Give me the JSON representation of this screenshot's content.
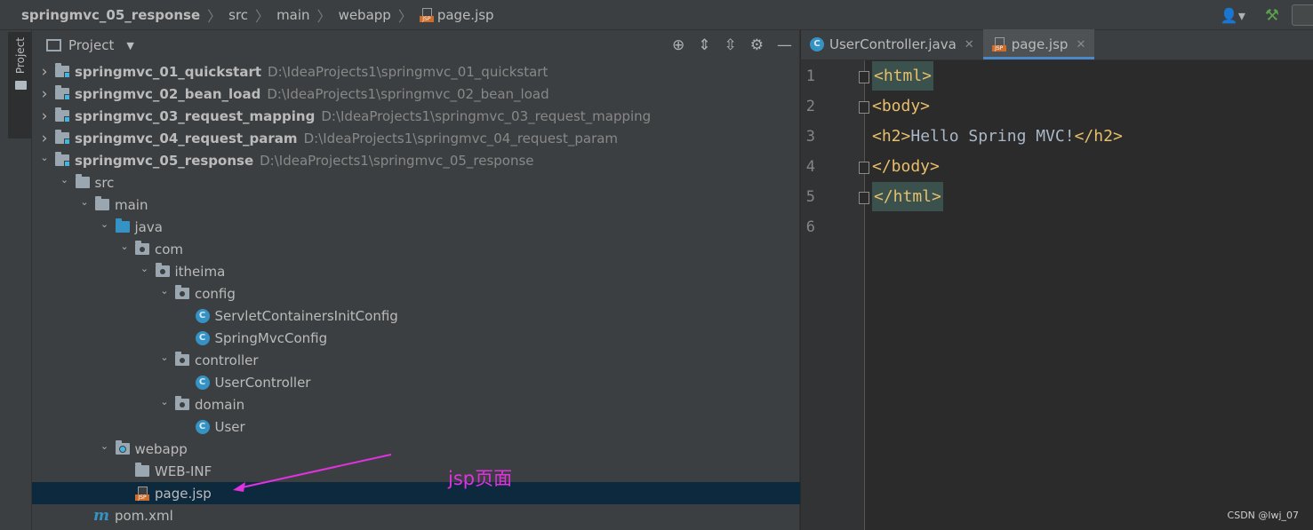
{
  "breadcrumb": [
    "springmvc_05_response",
    "src",
    "main",
    "webapp",
    "page.jsp"
  ],
  "project_panel": {
    "title": "Project",
    "stripe_label": "Project"
  },
  "tree": [
    {
      "name": "springmvc_01_quickstart",
      "path": "D:\\IdeaProjects1\\springmvc_01_quickstart",
      "level": 0,
      "arrow": "collapsed",
      "icon": "module-folder-icon",
      "bold": true
    },
    {
      "name": "springmvc_02_bean_load",
      "path": "D:\\IdeaProjects1\\springmvc_02_bean_load",
      "level": 0,
      "arrow": "collapsed",
      "icon": "module-folder-icon",
      "bold": true
    },
    {
      "name": "springmvc_03_request_mapping",
      "path": "D:\\IdeaProjects1\\springmvc_03_request_mapping",
      "level": 0,
      "arrow": "collapsed",
      "icon": "module-folder-icon",
      "bold": true
    },
    {
      "name": "springmvc_04_request_param",
      "path": "D:\\IdeaProjects1\\springmvc_04_request_param",
      "level": 0,
      "arrow": "collapsed",
      "icon": "module-folder-icon",
      "bold": true
    },
    {
      "name": "springmvc_05_response",
      "path": "D:\\IdeaProjects1\\springmvc_05_response",
      "level": 0,
      "arrow": "expanded",
      "icon": "module-folder-icon",
      "bold": true
    },
    {
      "name": "src",
      "path": "",
      "level": 1,
      "arrow": "expanded",
      "icon": "folder-icon"
    },
    {
      "name": "main",
      "path": "",
      "level": 2,
      "arrow": "expanded",
      "icon": "folder-icon"
    },
    {
      "name": "java",
      "path": "",
      "level": 3,
      "arrow": "expanded",
      "icon": "source-folder-icon"
    },
    {
      "name": "com",
      "path": "",
      "level": 4,
      "arrow": "expanded",
      "icon": "package-icon"
    },
    {
      "name": "itheima",
      "path": "",
      "level": 5,
      "arrow": "expanded",
      "icon": "package-icon"
    },
    {
      "name": "config",
      "path": "",
      "level": 6,
      "arrow": "expanded",
      "icon": "package-icon"
    },
    {
      "name": "ServletContainersInitConfig",
      "path": "",
      "level": 7,
      "arrow": "none",
      "icon": "class-icon"
    },
    {
      "name": "SpringMvcConfig",
      "path": "",
      "level": 7,
      "arrow": "none",
      "icon": "class-icon"
    },
    {
      "name": "controller",
      "path": "",
      "level": 6,
      "arrow": "expanded",
      "icon": "package-icon"
    },
    {
      "name": "UserController",
      "path": "",
      "level": 7,
      "arrow": "none",
      "icon": "class-icon"
    },
    {
      "name": "domain",
      "path": "",
      "level": 6,
      "arrow": "expanded",
      "icon": "package-icon"
    },
    {
      "name": "User",
      "path": "",
      "level": 7,
      "arrow": "none",
      "icon": "class-icon"
    },
    {
      "name": "webapp",
      "path": "",
      "level": 3,
      "arrow": "expanded",
      "icon": "web-folder-icon"
    },
    {
      "name": "WEB-INF",
      "path": "",
      "level": 4,
      "arrow": "none",
      "icon": "folder-icon"
    },
    {
      "name": "page.jsp",
      "path": "",
      "level": 4,
      "arrow": "none",
      "icon": "jsp-file-icon",
      "selected": true
    },
    {
      "name": "pom.xml",
      "path": "",
      "level": 2,
      "arrow": "none",
      "icon": "maven-icon"
    }
  ],
  "annotation": "jsp页面",
  "editor": {
    "tabs": [
      {
        "label": "UserController.java",
        "icon": "class-icon",
        "active": false
      },
      {
        "label": "page.jsp",
        "icon": "jsp-file-icon",
        "active": true
      }
    ],
    "line_numbers": [
      "1",
      "2",
      "3",
      "4",
      "5",
      "6"
    ],
    "lines": [
      {
        "open": "<html>",
        "text": "",
        "close": ""
      },
      {
        "open": "<body>",
        "text": "",
        "close": ""
      },
      {
        "open": "<h2>",
        "text": "Hello Spring MVC!",
        "close": "</h2>"
      },
      {
        "open": "</body>",
        "text": "",
        "close": ""
      },
      {
        "open": "</html>",
        "text": "",
        "close": ""
      },
      {
        "open": "",
        "text": "",
        "close": ""
      }
    ]
  },
  "watermark": "CSDN @lwj_07",
  "colors": {
    "tag": "#e8bf6a",
    "text": "#a9b7c6",
    "selection": "#0d293e",
    "annotation": "#e032e0",
    "accent": "#4a88c7"
  }
}
